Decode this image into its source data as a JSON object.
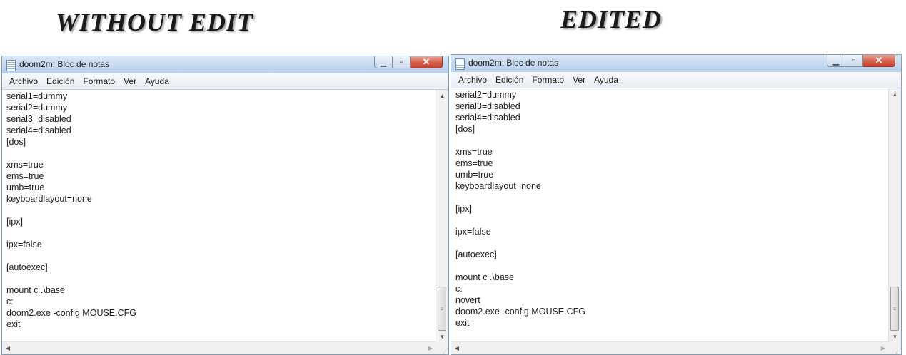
{
  "captions": {
    "left": "WITHOUT EDIT",
    "right": "EDITED"
  },
  "windows": [
    {
      "title": "doom2m: Bloc de notas",
      "menu": [
        "Archivo",
        "Edición",
        "Formato",
        "Ver",
        "Ayuda"
      ],
      "content": "serial1=dummy\nserial2=dummy\nserial3=disabled\nserial4=disabled\n[dos]\n\nxms=true\nems=true\numb=true\nkeyboardlayout=none\n\n[ipx]\n\nipx=false\n\n[autoexec]\n\nmount c .\\base\nc:\ndoom2.exe -config MOUSE.CFG\nexit"
    },
    {
      "title": "doom2m: Bloc de notas",
      "menu": [
        "Archivo",
        "Edición",
        "Formato",
        "Ver",
        "Ayuda"
      ],
      "content": "serial2=dummy\nserial3=disabled\nserial4=disabled\n[dos]\n\nxms=true\nems=true\numb=true\nkeyboardlayout=none\n\n[ipx]\n\nipx=false\n\n[autoexec]\n\nmount c .\\base\nc:\nnovert\ndoom2.exe -config MOUSE.CFG\nexit"
    }
  ],
  "icons": {
    "minimize": "minimize-icon",
    "maximize": "maximize-icon",
    "close": "close-icon",
    "app": "notepad-icon"
  },
  "colors": {
    "titlebar": "#c4d8ef",
    "close_button": "#d8634f",
    "menubar": "#eef1f6"
  }
}
